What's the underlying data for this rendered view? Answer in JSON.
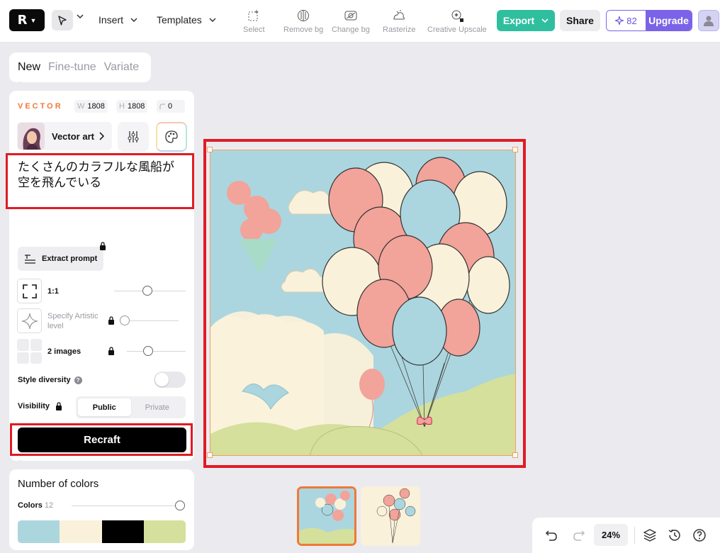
{
  "topbar": {
    "menus": [
      {
        "label": "Insert"
      },
      {
        "label": "Templates"
      }
    ],
    "tools": [
      {
        "label": "Select",
        "icon": "select-icon"
      },
      {
        "label": "Remove bg",
        "icon": "remove-bg-icon"
      },
      {
        "label": "Change bg",
        "icon": "change-bg-icon"
      },
      {
        "label": "Rasterize",
        "icon": "rasterize-icon"
      },
      {
        "label": "Creative Upscale",
        "icon": "creative-upscale-icon"
      }
    ],
    "export_label": "Export",
    "share_label": "Share",
    "credits": "82",
    "upgrade_label": "Upgrade"
  },
  "mode_tabs": [
    {
      "label": "New",
      "active": true
    },
    {
      "label": "Fine-tune",
      "active": false
    },
    {
      "label": "Variate",
      "active": false
    }
  ],
  "panel": {
    "type_label": "VECTOR",
    "width_key": "W",
    "width": "1808",
    "height_key": "H",
    "height": "1808",
    "corner": "0",
    "style_name": "Vector art",
    "prompt": "たくさんのカラフルな風船が空を飛んでいる",
    "extract_label": "Extract prompt",
    "aspect_label": "1:1",
    "artistic_label": "Specify Artistic level",
    "images_label": "2 images",
    "style_diversity_label": "Style diversity",
    "visibility_label": "Visibility",
    "visibility_options": [
      "Public",
      "Private"
    ],
    "visibility_selected": "Public",
    "recraft_label": "Recraft"
  },
  "colors": {
    "title": "Number of colors",
    "label": "Colors",
    "count": "12",
    "swatches": [
      "#acd6de",
      "#faf1da",
      "#000000",
      "#d5e09c"
    ]
  },
  "zoom": "24%",
  "accent": {
    "export": "#2fbf9f",
    "upgrade": "#7b63e8",
    "selection": "#f07838",
    "highlight": "#e01b24"
  }
}
